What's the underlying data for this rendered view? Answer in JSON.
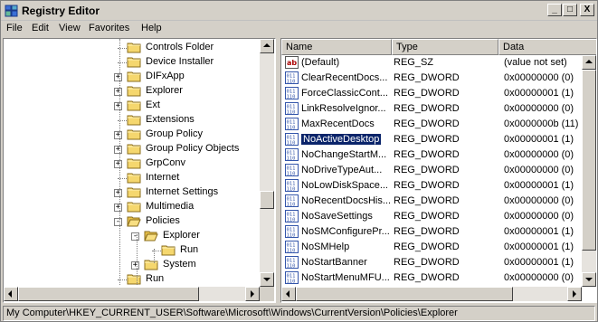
{
  "window": {
    "title": "Registry Editor",
    "minimize": "_",
    "maximize": "□",
    "close": "X"
  },
  "menu": [
    "File",
    "Edit",
    "View",
    "Favorites",
    "Help"
  ],
  "tree": [
    {
      "label": "Controls Folder",
      "expander": ""
    },
    {
      "label": "Device Installer",
      "expander": ""
    },
    {
      "label": "DIFxApp",
      "expander": "+"
    },
    {
      "label": "Explorer",
      "expander": "+"
    },
    {
      "label": "Ext",
      "expander": "+"
    },
    {
      "label": "Extensions",
      "expander": ""
    },
    {
      "label": "Group Policy",
      "expander": "+"
    },
    {
      "label": "Group Policy Objects",
      "expander": "+"
    },
    {
      "label": "GrpConv",
      "expander": "+"
    },
    {
      "label": "Internet",
      "expander": ""
    },
    {
      "label": "Internet Settings",
      "expander": "+"
    },
    {
      "label": "Multimedia",
      "expander": "+"
    },
    {
      "label": "Policies",
      "expander": "-"
    },
    {
      "label": "Explorer",
      "expander": "-"
    },
    {
      "label": "Run",
      "expander": ""
    },
    {
      "label": "System",
      "expander": "+"
    },
    {
      "label": "Run",
      "expander": ""
    }
  ],
  "columns": {
    "name": "Name",
    "type": "Type",
    "data": "Data"
  },
  "values": [
    {
      "icon": "string-value-icon",
      "name": "(Default)",
      "type": "REG_SZ",
      "data": "(value not set)"
    },
    {
      "icon": "dword-value-icon",
      "name": "ClearRecentDocs...",
      "type": "REG_DWORD",
      "data": "0x00000000 (0)"
    },
    {
      "icon": "dword-value-icon",
      "name": "ForceClassicCont...",
      "type": "REG_DWORD",
      "data": "0x00000001 (1)"
    },
    {
      "icon": "dword-value-icon",
      "name": "LinkResolveIgnor...",
      "type": "REG_DWORD",
      "data": "0x00000000 (0)"
    },
    {
      "icon": "dword-value-icon",
      "name": "MaxRecentDocs",
      "type": "REG_DWORD",
      "data": "0x0000000b (11)"
    },
    {
      "icon": "dword-value-icon",
      "name": "NoActiveDesktop",
      "type": "REG_DWORD",
      "data": "0x00000001 (1)",
      "selected": true
    },
    {
      "icon": "dword-value-icon",
      "name": "NoChangeStartM...",
      "type": "REG_DWORD",
      "data": "0x00000000 (0)"
    },
    {
      "icon": "dword-value-icon",
      "name": "NoDriveTypeAut...",
      "type": "REG_DWORD",
      "data": "0x00000000 (0)"
    },
    {
      "icon": "dword-value-icon",
      "name": "NoLowDiskSpace...",
      "type": "REG_DWORD",
      "data": "0x00000001 (1)"
    },
    {
      "icon": "dword-value-icon",
      "name": "NoRecentDocsHis...",
      "type": "REG_DWORD",
      "data": "0x00000000 (0)"
    },
    {
      "icon": "dword-value-icon",
      "name": "NoSaveSettings",
      "type": "REG_DWORD",
      "data": "0x00000000 (0)"
    },
    {
      "icon": "dword-value-icon",
      "name": "NoSMConfigurePr...",
      "type": "REG_DWORD",
      "data": "0x00000001 (1)"
    },
    {
      "icon": "dword-value-icon",
      "name": "NoSMHelp",
      "type": "REG_DWORD",
      "data": "0x00000001 (1)"
    },
    {
      "icon": "dword-value-icon",
      "name": "NoStartBanner",
      "type": "REG_DWORD",
      "data": "0x00000001 (1)"
    },
    {
      "icon": "dword-value-icon",
      "name": "NoStartMenuMFU...",
      "type": "REG_DWORD",
      "data": "0x00000000 (0)"
    }
  ],
  "status": "My Computer\\HKEY_CURRENT_USER\\Software\\Microsoft\\Windows\\CurrentVersion\\Policies\\Explorer",
  "colors": {
    "selection": "#0a246a",
    "chrome": "#d4d0c8",
    "folder": "#f5d76e"
  }
}
